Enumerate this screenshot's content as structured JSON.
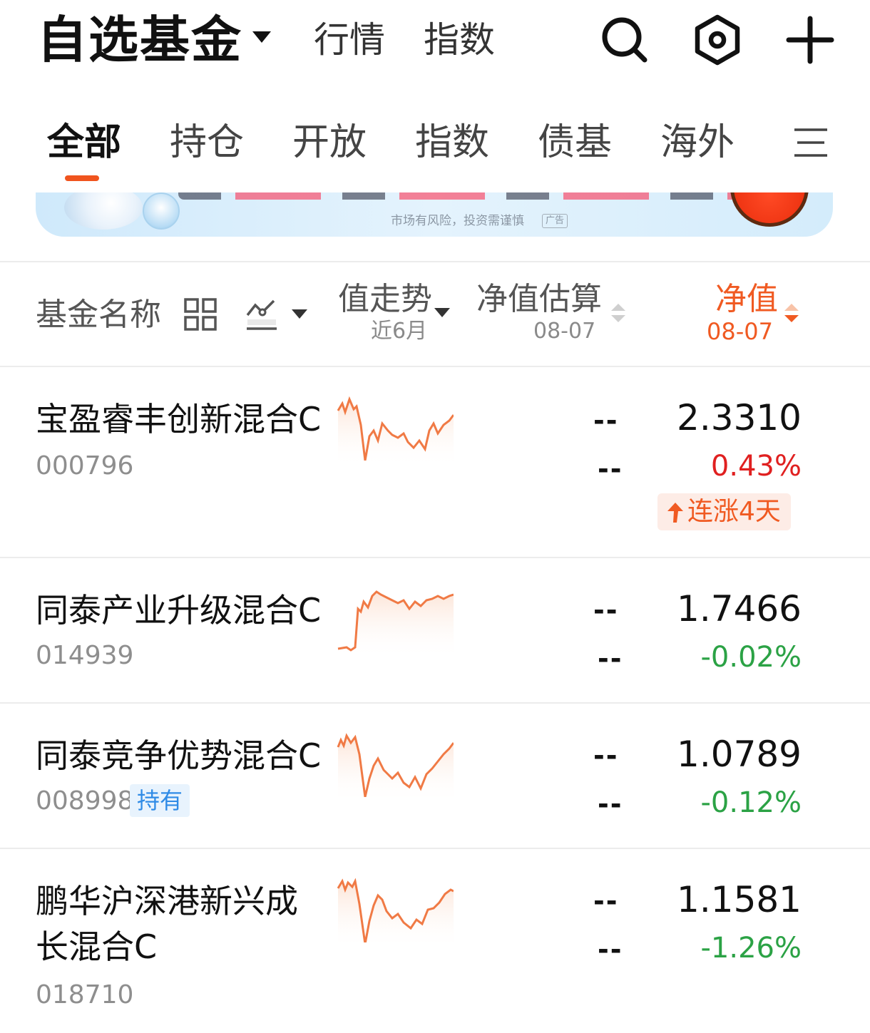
{
  "header": {
    "title": "自选基金",
    "links": [
      "行情",
      "指数"
    ],
    "icons": [
      "search-icon",
      "settings-hex-icon",
      "add-icon"
    ]
  },
  "tabs": {
    "items": [
      "全部",
      "持仓",
      "开放",
      "指数",
      "债基",
      "海外"
    ],
    "active_index": 0,
    "menu_icon": "more-menu-icon"
  },
  "banner": {
    "note": "市场有风险，投资需谨慎",
    "ad_tag": "广告"
  },
  "columns": {
    "name": "基金名称",
    "trend_title": "值走势",
    "trend_sub": "近6月",
    "estimate_title": "净值估算",
    "estimate_date": "08-07",
    "nav_title": "净值",
    "nav_date": "08-07",
    "accent_color": "#f05a22"
  },
  "funds": [
    {
      "name": "宝盈睿丰创新混合C",
      "code": "000796",
      "est_value": "--",
      "est_change": "--",
      "nav": "2.3310",
      "change": "0.43%",
      "direction": "up",
      "badge": "",
      "streak": "连涨4天"
    },
    {
      "name": "同泰产业升级混合C",
      "code": "014939",
      "est_value": "--",
      "est_change": "--",
      "nav": "1.7466",
      "change": "-0.02%",
      "direction": "down",
      "badge": "",
      "streak": ""
    },
    {
      "name": "同泰竞争优势混合C",
      "code": "008998",
      "est_value": "--",
      "est_change": "--",
      "nav": "1.0789",
      "change": "-0.12%",
      "direction": "down",
      "badge": "持有",
      "streak": ""
    },
    {
      "name": "鹏华沪深港新兴成长混合C",
      "code": "018710",
      "est_value": "--",
      "est_change": "--",
      "nav": "1.1581",
      "change": "-1.26%",
      "direction": "down",
      "badge": "",
      "streak": ""
    }
  ],
  "colors": {
    "up": "#e02020",
    "down": "#2ba245",
    "sparkline": "#f07a45"
  }
}
